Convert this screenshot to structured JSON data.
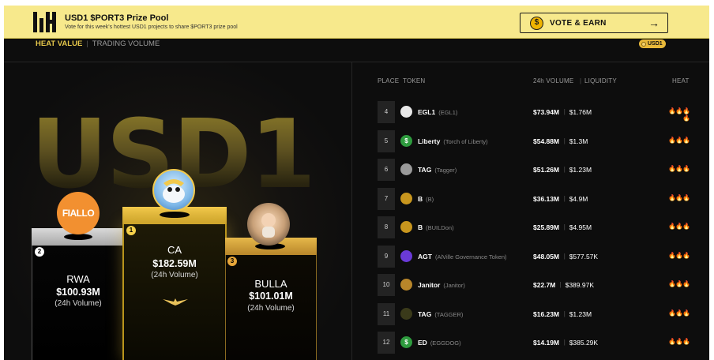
{
  "banner": {
    "title": "USD1 $PORT3 Prize Pool",
    "subtitle": "Vote for this week's hottest USD1 projects to share $PORT3 prize pool",
    "cta_label": "VOTE & EARN",
    "cta_arrow": "→",
    "coin_glyph": "$"
  },
  "tabs": {
    "heat_label": "HEAT VALUE",
    "separator": "|",
    "volume_label": "TRADING VOLUME",
    "badge_label": "USD1"
  },
  "hero": {
    "watermark": "USD1"
  },
  "podium": [
    {
      "rank": "1",
      "name": "CA",
      "value": "$182.59M",
      "sub": "(24h Volume)"
    },
    {
      "rank": "2",
      "name": "RWA",
      "value": "$100.93M",
      "sub": "(24h Volume)",
      "avatar_text": "FIALLO"
    },
    {
      "rank": "3",
      "name": "BULLA",
      "value": "$101.01M",
      "sub": "(24h Volume)"
    }
  ],
  "board": {
    "headers": {
      "place": "PLACE",
      "token": "TOKEN",
      "volume": "24h VOLUME",
      "separator": "|",
      "liquidity": "LIQUIDITY",
      "heat": "HEAT"
    },
    "rows": [
      {
        "place": "4",
        "symbol": "EGL1",
        "name": "(EGL1)",
        "volume": "$73.94M",
        "liquidity": "$1.76M",
        "heat": "🔥🔥🔥🔥",
        "icon_color": "#e8e8e8",
        "icon_glyph": ""
      },
      {
        "place": "5",
        "symbol": "Liberty",
        "name": "(Torch of Liberty)",
        "volume": "$54.88M",
        "liquidity": "$1.3M",
        "heat": "🔥🔥🔥",
        "icon_color": "#2e9b3e",
        "icon_glyph": "$"
      },
      {
        "place": "6",
        "symbol": "TAG",
        "name": "(Tagger)",
        "volume": "$51.26M",
        "liquidity": "$1.23M",
        "heat": "🔥🔥🔥",
        "icon_color": "#9a9a9a",
        "icon_glyph": ""
      },
      {
        "place": "7",
        "symbol": "B",
        "name": "(B)",
        "volume": "$36.13M",
        "liquidity": "$4.9M",
        "heat": "🔥🔥🔥",
        "icon_color": "#c8961e",
        "icon_glyph": ""
      },
      {
        "place": "8",
        "symbol": "B",
        "name": "(BUILDon)",
        "volume": "$25.89M",
        "liquidity": "$4.95M",
        "heat": "🔥🔥🔥",
        "icon_color": "#c8961e",
        "icon_glyph": ""
      },
      {
        "place": "9",
        "symbol": "AGT",
        "name": "(AlVille Governance Token)",
        "volume": "$48.05M",
        "liquidity": "$577.57K",
        "heat": "🔥🔥🔥",
        "icon_color": "#6a3ad8",
        "icon_glyph": ""
      },
      {
        "place": "10",
        "symbol": "Janitor",
        "name": "(Janitor)",
        "volume": "$22.7M",
        "liquidity": "$389.97K",
        "heat": "🔥🔥🔥",
        "icon_color": "#b8862a",
        "icon_glyph": ""
      },
      {
        "place": "11",
        "symbol": "TAG",
        "name": "(TAGGER)",
        "volume": "$16.23M",
        "liquidity": "$1.23M",
        "heat": "🔥🔥🔥",
        "icon_color": "#3a3a1a",
        "icon_glyph": ""
      },
      {
        "place": "12",
        "symbol": "ED",
        "name": "(EGGDOG)",
        "volume": "$14.19M",
        "liquidity": "$385.29K",
        "heat": "🔥🔥🔥",
        "icon_color": "#2e9b3e",
        "icon_glyph": "$"
      }
    ]
  }
}
